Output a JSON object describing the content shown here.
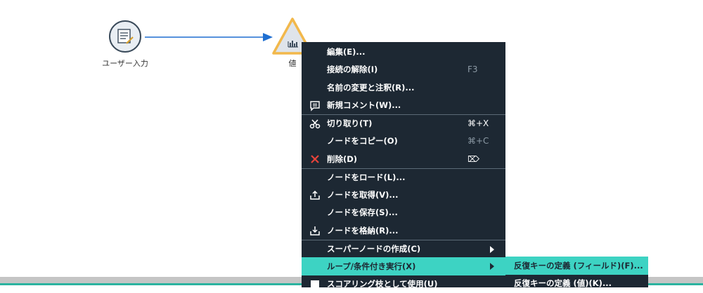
{
  "canvas": {
    "nodes": [
      {
        "id": "user-input",
        "label": "ユーザー入力",
        "icon": "table-edit-icon"
      },
      {
        "id": "values",
        "label": "値",
        "icon": "bar-chart-icon",
        "selected": true
      }
    ],
    "link_color": "#1f6fd1"
  },
  "context_menu": {
    "items": [
      {
        "label": "編集(E)...",
        "icon": "",
        "shortcut": ""
      },
      {
        "label": "接続の解除(I)",
        "icon": "",
        "shortcut": "F3"
      },
      {
        "label": "名前の変更と注釈(R)...",
        "icon": "",
        "shortcut": ""
      },
      {
        "label": "新規コメント(W)...",
        "icon": "comment-icon",
        "shortcut": ""
      },
      {
        "label": "切り取り(T)",
        "icon": "scissors-icon",
        "shortcut": "⌘+X"
      },
      {
        "label": "ノードをコピー(O)",
        "icon": "",
        "shortcut": "⌘+C"
      },
      {
        "label": "削除(D)",
        "icon": "delete-x-icon",
        "shortcut": "⌦"
      },
      {
        "label": "ノードをロード(L)...",
        "icon": "",
        "shortcut": ""
      },
      {
        "label": "ノードを取得(V)...",
        "icon": "upload-icon",
        "shortcut": ""
      },
      {
        "label": "ノードを保存(S)...",
        "icon": "",
        "shortcut": ""
      },
      {
        "label": "ノードを格納(R)...",
        "icon": "download-icon",
        "shortcut": ""
      },
      {
        "label": "スーパーノードの作成(C)",
        "icon": "",
        "shortcut": ""
      },
      {
        "label": "ループ/条件付き実行(X)",
        "icon": "",
        "shortcut": ""
      },
      {
        "label": "スコアリング枝として使用(U)",
        "icon": "square-icon",
        "shortcut": ""
      }
    ],
    "active_index": 12
  },
  "submenu": {
    "items": [
      {
        "label": "反復キーの定義 (フィールド)(F)..."
      },
      {
        "label": "反復キーの定義 (値)(K)..."
      }
    ],
    "active_index": 0
  },
  "colors": {
    "menu_bg": "#1d2833",
    "highlight": "#3dd3c3",
    "node_selected": "#f2b84b",
    "delete_icon": "#e8433a"
  }
}
